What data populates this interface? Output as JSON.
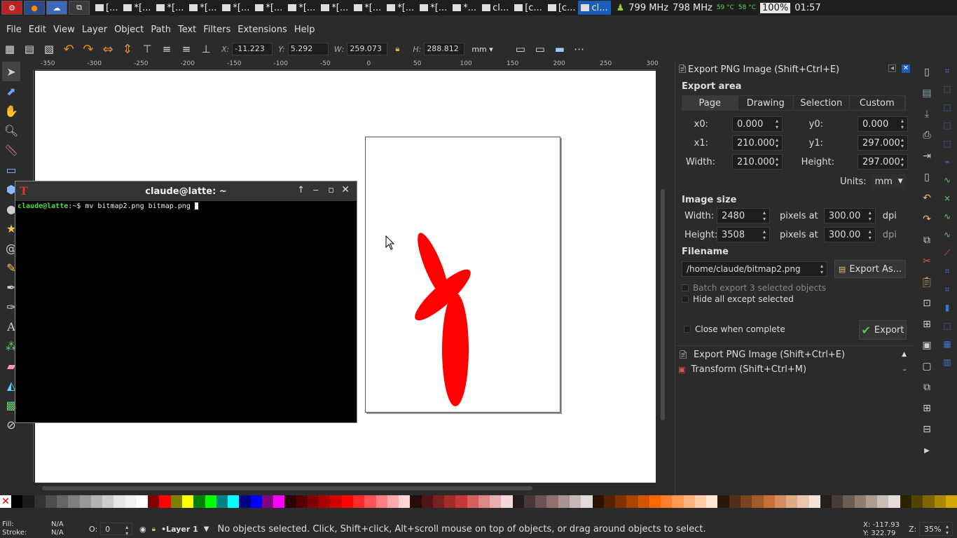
{
  "taskbar": {
    "windows": [
      {
        "label": "[...",
        "active": false
      },
      {
        "label": "*[...",
        "active": false
      },
      {
        "label": "*[...",
        "active": false
      },
      {
        "label": "*[...",
        "active": false
      },
      {
        "label": "*[...",
        "active": false
      },
      {
        "label": "*[...",
        "active": false
      },
      {
        "label": "*[...",
        "active": false
      },
      {
        "label": "*[...",
        "active": false
      },
      {
        "label": "*[...",
        "active": false
      },
      {
        "label": "*[...",
        "active": false
      },
      {
        "label": "*[...",
        "active": false
      },
      {
        "label": "*...",
        "active": false
      },
      {
        "label": "cl...",
        "active": false
      },
      {
        "label": "[c...",
        "active": false
      },
      {
        "label": "[c...",
        "active": false
      },
      {
        "label": "cl...",
        "active": true
      }
    ],
    "cpu1": "799 MHz",
    "cpu2": "798 MHz",
    "temp1": "59 °C",
    "temp2": "58 °C",
    "battery": "100%",
    "clock": "01:57"
  },
  "menu": [
    "File",
    "Edit",
    "View",
    "Layer",
    "Object",
    "Path",
    "Text",
    "Filters",
    "Extensions",
    "Help"
  ],
  "toolctrl": {
    "x_label": "X:",
    "x": "-11.223",
    "y_label": "Y:",
    "y": "5.292",
    "w_label": "W:",
    "w": "259.073",
    "h_label": "H:",
    "h": "288.812",
    "unit": "mm"
  },
  "ruler": {
    "h_ticks": [
      "-350",
      "-300",
      "-250",
      "-200",
      "-150",
      "-100",
      "-50",
      "0",
      "50",
      "100",
      "150",
      "200",
      "250",
      "300"
    ]
  },
  "terminal": {
    "title": "claude@latte: ~",
    "prompt": "claude@latte",
    "path": ":~$",
    "command": " mv bitmap2.png bitmap.png "
  },
  "export": {
    "panel_title": "Export PNG Image (Shift+Ctrl+E)",
    "export_area": "Export area",
    "tabs": [
      "Page",
      "Drawing",
      "Selection",
      "Custom"
    ],
    "selected_tab": "Page",
    "x0_label": "x0:",
    "x0": "0.000",
    "y0_label": "y0:",
    "y0": "0.000",
    "x1_label": "x1:",
    "x1": "210.000",
    "y1_label": "y1:",
    "y1": "297.000",
    "width_label": "Width:",
    "width": "210.000",
    "height_label": "Height:",
    "height": "297.000",
    "units_label": "Units:",
    "units": "mm",
    "image_size": "Image size",
    "img_width_label": "Width:",
    "img_width": "2480",
    "img_height_label": "Height:",
    "img_height": "3508",
    "pixels_at": "pixels at",
    "dpi_x": "300.00",
    "dpi_y": "300.00",
    "dpi": "dpi",
    "filename_label": "Filename",
    "filename": "/home/claude/bitmap2.png",
    "export_as": "Export As...",
    "batch": "Batch export 3 selected objects",
    "hide_all": "Hide all except selected",
    "close_when_complete": "Close when complete",
    "export_button": "Export"
  },
  "docked": [
    "Export PNG Image (Shift+Ctrl+E)",
    "Transform (Shift+Ctrl+M)"
  ],
  "status": {
    "fill_label": "Fill:",
    "fill": "N/A",
    "stroke_label": "Stroke:",
    "stroke": "N/A",
    "opacity_label": "O:",
    "opacity": "0",
    "layer": "•Layer 1",
    "message": "No objects selected. Click, Shift+click, Alt+scroll mouse on top of objects, or drag around objects to select.",
    "cursor_x": "X: -117.93",
    "cursor_y": "Y:  322.79",
    "zoom_label": "Z:",
    "zoom": "35%"
  },
  "colors": {
    "shape_fill": "#ff0000",
    "accent": "#1c5db8",
    "palette": [
      "#000000",
      "#1a1a1a",
      "#333333",
      "#4d4d4d",
      "#666666",
      "#808080",
      "#999999",
      "#b3b3b3",
      "#cccccc",
      "#e6e6e6",
      "#f2f2f2",
      "#ffffff",
      "#800000",
      "#ff0000",
      "#808000",
      "#ffff00",
      "#008000",
      "#00ff00",
      "#008080",
      "#00ffff",
      "#000080",
      "#0000ff",
      "#800080",
      "#ff00ff",
      "#2b0000",
      "#550000",
      "#800000",
      "#aa0000",
      "#d40000",
      "#ff0000",
      "#ff2a2a",
      "#ff5555",
      "#ff8080",
      "#ffaaaa",
      "#ffd5d5",
      "#280b0b",
      "#501616",
      "#782121",
      "#a02c2c",
      "#c83737",
      "#d35f5f",
      "#de8787",
      "#e9afaf",
      "#f4d7d7",
      "#241c1c",
      "#483737",
      "#6c5353",
      "#916f6f",
      "#ac9393",
      "#c8b7b7",
      "#e3dbdb",
      "#2b1100",
      "#552200",
      "#803300",
      "#aa4400",
      "#d45500",
      "#ff6600",
      "#ff7f2a",
      "#ff9955",
      "#ffb380",
      "#ffccaa",
      "#ffe6d5",
      "#28170b",
      "#502d16",
      "#784421",
      "#a05a2c",
      "#c87137",
      "#d38d5f",
      "#deaa87",
      "#e9c6af",
      "#f4e3d7",
      "#241f1c",
      "#483e37",
      "#6c5d53",
      "#917c6f",
      "#ac9d93",
      "#c8beb7",
      "#e3dedb",
      "#2b2200",
      "#554400",
      "#806600",
      "#aa8800",
      "#d4aa00"
    ]
  }
}
